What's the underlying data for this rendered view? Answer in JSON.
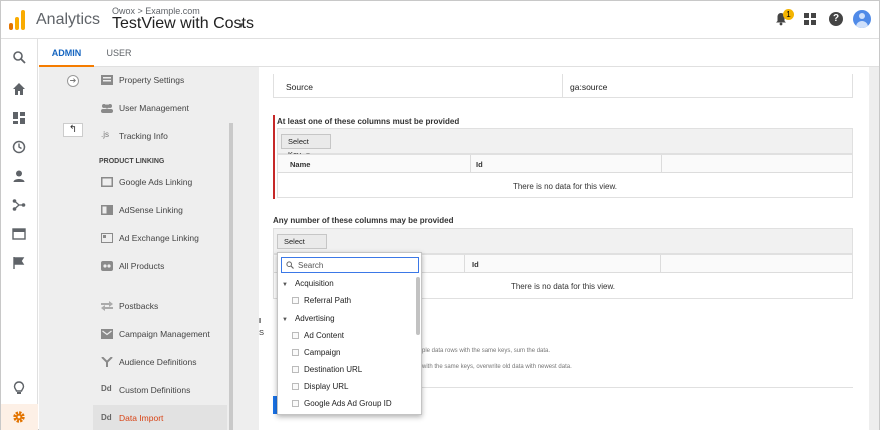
{
  "header": {
    "app_name": "Analytics",
    "account_path": "Owox > Example.com",
    "view_name": "TestView with Costs",
    "notification_count": "1",
    "help_glyph": "?"
  },
  "tabs": [
    {
      "label": "ADMIN",
      "active": true
    },
    {
      "label": "USER",
      "active": false
    }
  ],
  "rail_icons": [
    "search-icon",
    "home-icon",
    "customization-icon",
    "clock-icon",
    "person-icon",
    "acquisition-icon",
    "behavior-icon",
    "flag-icon",
    "lightbulb-icon",
    "gear-icon"
  ],
  "sidebar": {
    "section_label": "PRODUCT LINKING",
    "items": [
      {
        "label": "Property Settings",
        "icon": "property-settings-icon"
      },
      {
        "label": "User Management",
        "icon": "users-icon"
      },
      {
        "label": "Tracking Info",
        "icon": "js-icon",
        "icon_text": ".js"
      },
      {
        "label": "Google Ads Linking",
        "icon": "ads-link-icon"
      },
      {
        "label": "AdSense Linking",
        "icon": "adsense-icon"
      },
      {
        "label": "Ad Exchange Linking",
        "icon": "ad-exchange-icon"
      },
      {
        "label": "All Products",
        "icon": "all-products-icon"
      },
      {
        "label": "Postbacks",
        "icon": "postbacks-icon"
      },
      {
        "label": "Campaign Management",
        "icon": "campaign-icon"
      },
      {
        "label": "Audience Definitions",
        "icon": "audience-icon"
      },
      {
        "label": "Custom Definitions",
        "icon": "dd-icon",
        "icon_text": "Dd"
      },
      {
        "label": "Data Import",
        "icon": "dd-icon",
        "icon_text": "Dd",
        "active": true
      }
    ]
  },
  "main": {
    "source_row": {
      "name": "Source",
      "id": "ga:source"
    },
    "required_section": {
      "title": "At least one of these columns must be provided",
      "select_key_label": "Select Key",
      "columns": [
        "Name",
        "Id"
      ],
      "empty_message": "There is no data for this view."
    },
    "optional_section": {
      "title": "Any number of these columns may be provided",
      "select_key_label": "Select Key",
      "columns": [
        "Id"
      ],
      "empty_message": "There is no data for this view."
    },
    "import_fragment_1": "I",
    "import_fragment_2": "S",
    "faded_text_1": "ple data rows with the same keys, sum the data.",
    "faded_text_2": "with the same keys, overwrite old data with newest data."
  },
  "dropdown": {
    "search_placeholder": "Search",
    "groups": [
      {
        "label": "Acquisition",
        "items": [
          "Referral Path"
        ]
      },
      {
        "label": "Advertising",
        "items": [
          "Ad Content",
          "Campaign",
          "Destination URL",
          "Display URL",
          "Google Ads Ad Group ID"
        ]
      }
    ]
  },
  "colors": {
    "accent_orange": "#f57c00",
    "link_blue": "#1565c0",
    "required_red": "#c62828",
    "active_nav_text": "#d84315"
  }
}
